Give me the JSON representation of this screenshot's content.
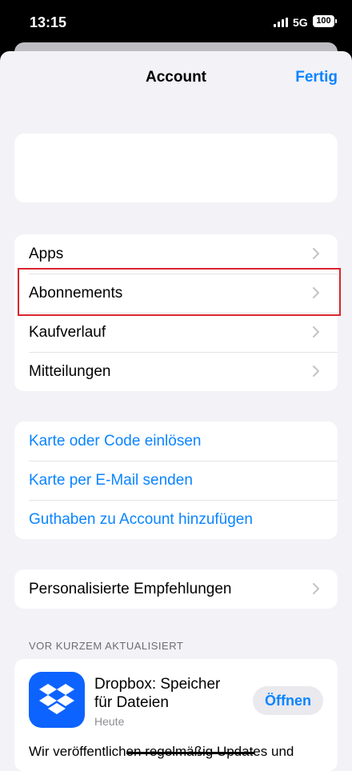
{
  "status": {
    "time": "13:15",
    "network": "5G",
    "battery": "100"
  },
  "nav": {
    "title": "Account",
    "done_label": "Fertig"
  },
  "menu": [
    {
      "label": "Apps"
    },
    {
      "label": "Abonnements"
    },
    {
      "label": "Kaufverlauf"
    },
    {
      "label": "Mitteilungen"
    }
  ],
  "links": [
    {
      "label": "Karte oder Code einlösen"
    },
    {
      "label": "Karte per E-Mail senden"
    },
    {
      "label": "Guthaben zu Account hinzufügen"
    }
  ],
  "personalized": {
    "label": "Personalisierte Empfehlungen"
  },
  "recent": {
    "header": "VOR KURZEM AKTUALISIERT",
    "app": {
      "name": "Dropbox: Speicher für Dateien",
      "date": "Heute",
      "open_label": "Öffnen",
      "icon": "dropbox-icon",
      "description": "Wir veröffentlichen regelmäßig Updates und"
    }
  },
  "colors": {
    "accent": "#0a84ff",
    "highlight": "#d9262f",
    "dropbox": "#0d63ff"
  }
}
